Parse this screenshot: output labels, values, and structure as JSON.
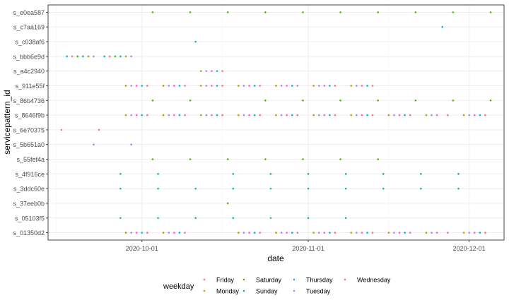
{
  "chart_data": {
    "type": "scatter",
    "title": "",
    "xlabel": "date",
    "ylabel": "servicepattern_id",
    "xlim": [
      "2020-09-16",
      "2020-12-05"
    ],
    "x_ticks": [
      {
        "date": "2020-10-01",
        "label": "2020-10-01"
      },
      {
        "date": "2020-11-01",
        "label": "2020-11-01"
      },
      {
        "date": "2020-12-01",
        "label": "2020-12-01"
      }
    ],
    "categories": [
      "s_01350d2",
      "s_05103f5",
      "s_37eeb0b",
      "s_3ddc60e",
      "s_4f916ce",
      "s_55fef4a",
      "s_5b651a0",
      "s_6e70375",
      "s_8646f9b",
      "s_86b4736",
      "s_911e55f",
      "s_a4c2940",
      "s_bbb6e9d",
      "s_c038af6",
      "s_c7aa169",
      "s_e0ea587"
    ],
    "grid": true,
    "legend": {
      "title": "weekday",
      "position": "bottom",
      "entries": [
        {
          "label": "Friday",
          "color": "#F8766D"
        },
        {
          "label": "Monday",
          "color": "#C49A00"
        },
        {
          "label": "Saturday",
          "color": "#53B400"
        },
        {
          "label": "Sunday",
          "color": "#00C094"
        },
        {
          "label": "Thursday",
          "color": "#00B6EB"
        },
        {
          "label": "Tuesday",
          "color": "#A58AFF"
        },
        {
          "label": "Wednesday",
          "color": "#FB61D7"
        }
      ]
    },
    "series": [
      {
        "name": "s_01350d2",
        "x": [
          "2020-09-28",
          "2020-09-29",
          "2020-09-30",
          "2020-10-01",
          "2020-10-02",
          "2020-10-05",
          "2020-10-06",
          "2020-10-07",
          "2020-10-08",
          "2020-10-09",
          "2020-10-19",
          "2020-10-20",
          "2020-10-21",
          "2020-10-22",
          "2020-10-23",
          "2020-10-26",
          "2020-10-27",
          "2020-10-28",
          "2020-10-29",
          "2020-10-30",
          "2020-11-02",
          "2020-11-03",
          "2020-11-04",
          "2020-11-05",
          "2020-11-06",
          "2020-11-09",
          "2020-11-10",
          "2020-11-11",
          "2020-11-12",
          "2020-11-13",
          "2020-11-16",
          "2020-11-17",
          "2020-11-18",
          "2020-11-19",
          "2020-11-20",
          "2020-11-23",
          "2020-11-24",
          "2020-11-25",
          "2020-11-27",
          "2020-11-30",
          "2020-12-01",
          "2020-12-02",
          "2020-12-03",
          "2020-12-04"
        ]
      },
      {
        "name": "s_05103f5",
        "x": [
          "2020-09-27",
          "2020-10-04",
          "2020-10-11",
          "2020-10-18",
          "2020-10-25",
          "2020-11-01",
          "2020-11-08"
        ]
      },
      {
        "name": "s_37eeb0b",
        "x": [
          "2020-10-17"
        ]
      },
      {
        "name": "s_3ddc60e",
        "x": [
          "2020-09-27",
          "2020-10-04",
          "2020-10-11",
          "2020-10-18",
          "2020-10-25",
          "2020-11-01",
          "2020-11-08",
          "2020-11-15",
          "2020-11-22",
          "2020-11-29"
        ]
      },
      {
        "name": "s_4f916ce",
        "x": [
          "2020-09-27",
          "2020-10-04",
          "2020-10-18",
          "2020-10-25",
          "2020-11-01",
          "2020-11-08",
          "2020-11-15",
          "2020-11-22",
          "2020-11-29"
        ]
      },
      {
        "name": "s_55fef4a",
        "x": [
          "2020-10-03",
          "2020-10-10",
          "2020-10-17",
          "2020-10-24",
          "2020-10-31",
          "2020-11-07",
          "2020-11-14"
        ]
      },
      {
        "name": "s_5b651a0",
        "x": [
          "2020-09-22",
          "2020-09-29"
        ]
      },
      {
        "name": "s_6e70375",
        "x": [
          "2020-09-16",
          "2020-09-23"
        ]
      },
      {
        "name": "s_8646f9b",
        "x": [
          "2020-09-28",
          "2020-09-29",
          "2020-09-30",
          "2020-10-01",
          "2020-10-02",
          "2020-10-05",
          "2020-10-06",
          "2020-10-07",
          "2020-10-08",
          "2020-10-09",
          "2020-10-12",
          "2020-10-13",
          "2020-10-14",
          "2020-10-15",
          "2020-10-16",
          "2020-10-19",
          "2020-10-20",
          "2020-10-21",
          "2020-10-22",
          "2020-10-23",
          "2020-10-26",
          "2020-10-27",
          "2020-10-28",
          "2020-10-29",
          "2020-10-30",
          "2020-11-02",
          "2020-11-03",
          "2020-11-04",
          "2020-11-05",
          "2020-11-06",
          "2020-11-09",
          "2020-11-10",
          "2020-11-11",
          "2020-11-12",
          "2020-11-13",
          "2020-11-16",
          "2020-11-17",
          "2020-11-18",
          "2020-11-19",
          "2020-11-20",
          "2020-11-23",
          "2020-11-24",
          "2020-11-25",
          "2020-11-27",
          "2020-11-30",
          "2020-12-01",
          "2020-12-02",
          "2020-12-03",
          "2020-12-04"
        ]
      },
      {
        "name": "s_86b4736",
        "x": [
          "2020-10-03",
          "2020-10-10",
          "2020-10-24",
          "2020-10-31",
          "2020-11-07",
          "2020-11-14",
          "2020-11-21",
          "2020-11-28",
          "2020-12-05"
        ]
      },
      {
        "name": "s_911e55f",
        "x": [
          "2020-09-28",
          "2020-09-29",
          "2020-09-30",
          "2020-10-01",
          "2020-10-02",
          "2020-10-05",
          "2020-10-06",
          "2020-10-07",
          "2020-10-08",
          "2020-10-09",
          "2020-10-12",
          "2020-10-13",
          "2020-10-14",
          "2020-10-15",
          "2020-10-16",
          "2020-10-19",
          "2020-10-20",
          "2020-10-21",
          "2020-10-22",
          "2020-10-23",
          "2020-10-26",
          "2020-10-27",
          "2020-10-28",
          "2020-10-29",
          "2020-10-30",
          "2020-11-02",
          "2020-11-03",
          "2020-11-04",
          "2020-11-05",
          "2020-11-06",
          "2020-11-09",
          "2020-11-10",
          "2020-11-11",
          "2020-11-12",
          "2020-11-13"
        ]
      },
      {
        "name": "s_a4c2940",
        "x": [
          "2020-10-12",
          "2020-10-13",
          "2020-10-14",
          "2020-10-15",
          "2020-10-16"
        ]
      },
      {
        "name": "s_bbb6e9d",
        "x": [
          "2020-09-17",
          "2020-09-18",
          "2020-09-19",
          "2020-09-20",
          "2020-09-21",
          "2020-09-22",
          "2020-09-24",
          "2020-09-25",
          "2020-09-26",
          "2020-09-27",
          "2020-09-28",
          "2020-09-29"
        ]
      },
      {
        "name": "s_c038af6",
        "x": [
          "2020-10-11"
        ]
      },
      {
        "name": "s_c7aa169",
        "x": [
          "2020-11-26"
        ]
      },
      {
        "name": "s_e0ea587",
        "x": [
          "2020-10-03",
          "2020-10-10",
          "2020-10-17",
          "2020-10-24",
          "2020-10-31",
          "2020-11-07",
          "2020-11-14",
          "2020-11-21",
          "2020-11-28",
          "2020-12-05"
        ]
      }
    ]
  }
}
